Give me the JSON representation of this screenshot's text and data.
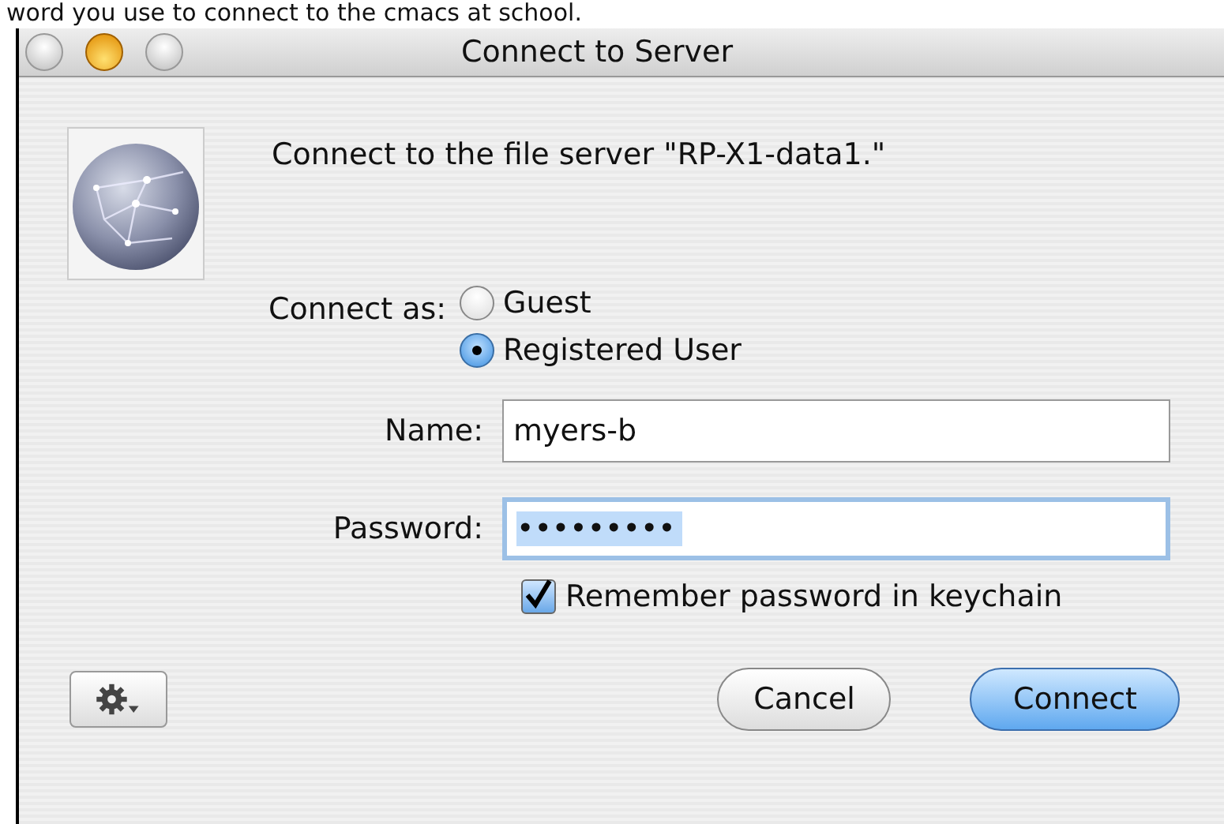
{
  "caption": "word you use to connect to the cmacs at school.",
  "window": {
    "title": "Connect to Server"
  },
  "message": "Connect to the file server \"RP-X1-data1.\"",
  "connect_as": {
    "label": "Connect as:",
    "options": [
      {
        "label": "Guest",
        "selected": false
      },
      {
        "label": "Registered User",
        "selected": true
      }
    ]
  },
  "fields": [
    {
      "label": "Name:",
      "value": "myers-b",
      "focused": false
    },
    {
      "label": "Password:",
      "value": "•••••••••",
      "focused": true
    }
  ],
  "remember": {
    "label": "Remember password in keychain",
    "checked": true
  },
  "buttons": [
    {
      "label": "Cancel",
      "default": false
    },
    {
      "label": "Connect",
      "default": true
    }
  ]
}
